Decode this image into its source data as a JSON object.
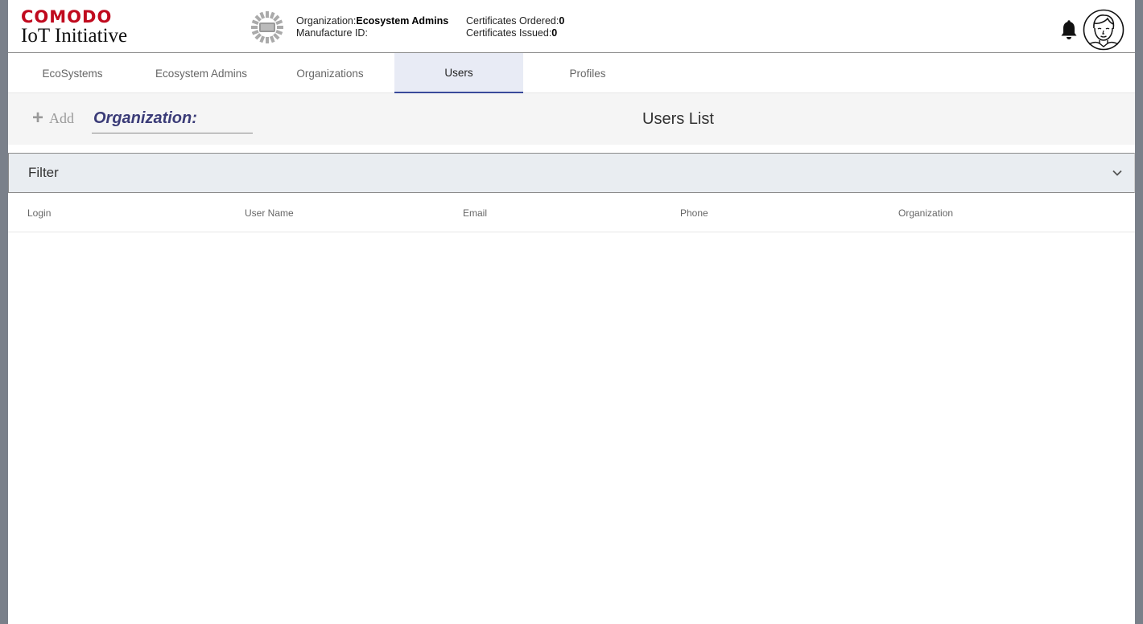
{
  "brand": {
    "top": "COMODO",
    "bottom": "IoT Initiative"
  },
  "org_logo_icon": "org-logo-placeholder-icon",
  "org_info": {
    "org_label": "Organization:",
    "org_value": "Ecosystem Admins",
    "manufacture_label": "Manufacture ID:",
    "manufacture_value": ""
  },
  "cert_info": {
    "ordered_label": "Certificates Ordered:",
    "ordered_value": "0",
    "issued_label": "Certificates Issued:",
    "issued_value": "0"
  },
  "header_icons": {
    "bell": "bell-icon",
    "avatar": "user-avatar-icon"
  },
  "tabs": [
    {
      "label": "EcoSystems"
    },
    {
      "label": "Ecosystem Admins"
    },
    {
      "label": "Organizations"
    },
    {
      "label": "Users",
      "active": true
    },
    {
      "label": "Profiles"
    }
  ],
  "toolbar": {
    "add_icon": "+",
    "add_label": "Add",
    "org_select_label": "Organization:",
    "list_title": "Users List"
  },
  "filter": {
    "label": "Filter"
  },
  "table": {
    "columns": [
      "Login",
      "User Name",
      "Email",
      "Phone",
      "Organization"
    ]
  },
  "colors": {
    "brand_red": "#c00a1e",
    "active_tab_bg": "#e8ebf5",
    "active_tab_border": "#3a4a9a",
    "org_select": "#3b3c78",
    "filter_bg": "#e9edf1"
  }
}
